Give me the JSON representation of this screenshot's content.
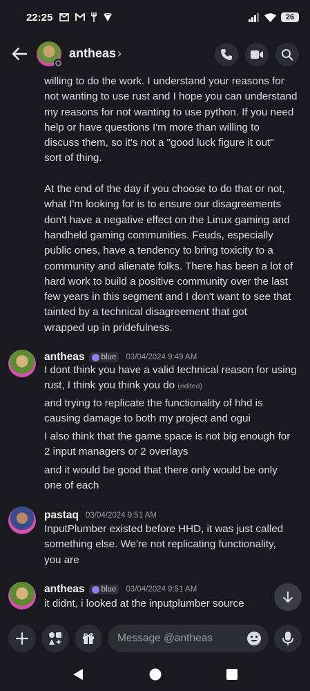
{
  "status": {
    "time": "22:25",
    "battery": "26",
    "notif_icons": [
      "gmail-icon",
      "gmail-m-icon",
      "fork-icon",
      "tesla-icon"
    ]
  },
  "header": {
    "name": "antheas",
    "chevron": "›"
  },
  "messages": {
    "continuation_lines": [
      "willing to do the work. I understand your reasons for",
      "not wanting to use rust and I hope you can understand",
      "my reasons for not wanting to use python. If you need",
      "help or have questions I'm more than willing to",
      "discuss them, so it's not a \"good luck figure it out\"",
      "sort of thing.",
      "",
      "At the end of the day if you choose to do that or not,",
      "what I'm looking for is to ensure our disagreements",
      "don't have a negative effect on the Linux gaming and",
      "handheld gaming communities. Feuds, especially",
      "public ones, have a tendency to bring toxicity to a",
      "community and alienate folks. There has been a lot of",
      "hard work to build a positive community over the last",
      "few years in this segment and I don't want to see that",
      "tainted by a technical disagreement that got",
      "wrapped up in pridefulness."
    ],
    "group1": {
      "author": "antheas",
      "tag": "blue",
      "timestamp": "03/04/2024 9:49 AM",
      "msg1_line1": "I dont think you have a valid technical reason for using",
      "msg1_line2": "rust, I think you think you do",
      "edited": "(edited)",
      "msg2_line1": "and trying to replicate the functionality of hhd is",
      "msg2_line2": "causing damage to both my project and ogui",
      "msg3_line1": "I also think that the game space is not big enough for",
      "msg3_line2": "2 input managers or 2 overlays",
      "msg4_line1": "and it would be good that there only would be only",
      "msg4_line2": "one of each"
    },
    "group2": {
      "author": "pastaq",
      "timestamp": "03/04/2024 9:51 AM",
      "line1": "InputPlumber existed before HHD, it was just called",
      "line2": "something else. We're not replicating functionality,",
      "line3": "you are"
    },
    "group3": {
      "author": "antheas",
      "tag": "blue",
      "timestamp": "03/04/2024 9:51 AM",
      "line1": "it didnt, i looked at the inputplumber source"
    }
  },
  "composer": {
    "placeholder": "Message @antheas"
  }
}
